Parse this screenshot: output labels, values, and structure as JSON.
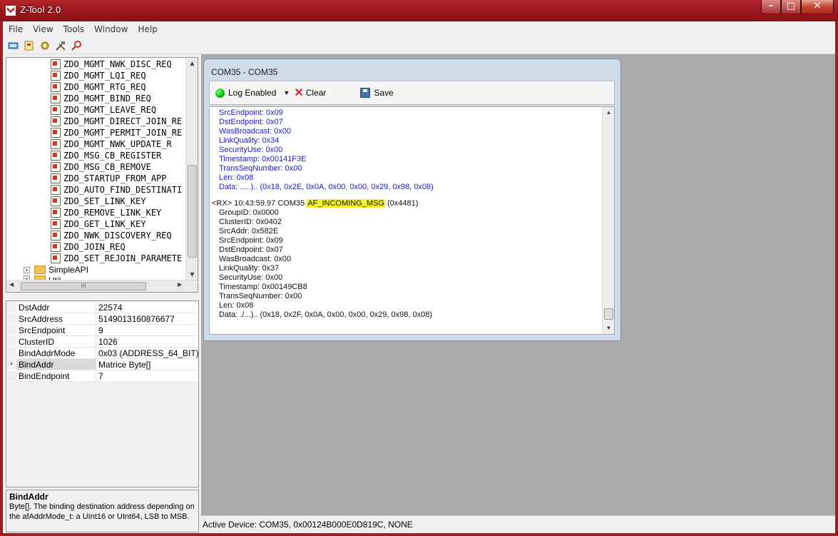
{
  "window": {
    "title": "Z-Tool 2.0",
    "minimize": "–",
    "maximize": "□",
    "close": "✕"
  },
  "menu": [
    "File",
    "View",
    "Tools",
    "Window",
    "Help"
  ],
  "toolbar": {
    "icons": [
      "device-icon",
      "open-icon",
      "settings-icon",
      "tools-icon",
      "search-icon"
    ]
  },
  "tree": {
    "items": [
      "ZDO_MGMT_NWK_DISC_REQ",
      "ZDO_MGMT_LQI_REQ",
      "ZDO_MGMT_RTG_REQ",
      "ZDO_MGMT_BIND_REQ",
      "ZDO_MGMT_LEAVE_REQ",
      "ZDO_MGMT_DIRECT_JOIN_RE",
      "ZDO_MGMT_PERMIT_JOIN_RE",
      "ZDO_MGMT_NWK_UPDATE_R",
      "ZDO_MSG_CB_REGISTER",
      "ZDO_MSG_CB_REMOVE",
      "ZDO_STARTUP_FROM_APP",
      "ZDO_AUTO_FIND_DESTINATI",
      "ZDO_SET_LINK_KEY",
      "ZDO_REMOVE_LINK_KEY",
      "ZDO_GET_LINK_KEY",
      "ZDO_NWK_DISCOVERY_REQ",
      "ZDO_JOIN_REQ",
      "ZDO_SET_REJOIN_PARAMETE"
    ],
    "folders": [
      "SimpleAPI",
      "Util"
    ],
    "hscroll_glyph": "III"
  },
  "properties": [
    {
      "name": "DstAddr",
      "value": "22574",
      "expander": ""
    },
    {
      "name": "SrcAddress",
      "value": "5149013160876677",
      "expander": ""
    },
    {
      "name": "SrcEndpoint",
      "value": "9",
      "expander": ""
    },
    {
      "name": "ClusterID",
      "value": "1026",
      "expander": ""
    },
    {
      "name": "BindAddrMode",
      "value": "0x03 (ADDRESS_64_BIT)",
      "expander": ""
    },
    {
      "name": "BindAddr",
      "value": "Matrice Byte[]",
      "expander": "+"
    },
    {
      "name": "BindEndpoint",
      "value": "7",
      "expander": ""
    }
  ],
  "help": {
    "title": "BindAddr",
    "text": "Byte[].  The binding destination address depending on the afAddrMode_t: a UInt16 or UInt64, LSB to MSB."
  },
  "child_window": {
    "title": "COM35 - COM35",
    "log_enabled_label": "Log Enabled",
    "clear_label": "Clear",
    "save_label": "Save"
  },
  "log": {
    "prev_lines": [
      "SrcEndpoint: 0x09",
      "DstEndpoint: 0x07",
      "WasBroadcast: 0x00",
      "LinkQuality: 0x34",
      "SecurityUse: 0x00",
      "Timestamp: 0x00141F3E",
      "TransSeqNumber: 0x00",
      "Len: 0x08",
      "Data: .....).. (0x18, 0x2E, 0x0A, 0x00, 0x00, 0x29, 0x98, 0x08)"
    ],
    "rx_prefix": "<RX> 10:43:59.97 COM35 ",
    "rx_msg": "AF_INCOMING_MSG",
    "rx_suffix": " (0x4481)",
    "cur_lines": [
      "GroupID: 0x0000",
      "ClusterID: 0x0402",
      "SrcAddr: 0x582E",
      "SrcEndpoint: 0x09",
      "DstEndpoint: 0x07",
      "WasBroadcast: 0x00",
      "LinkQuality: 0x37",
      "SecurityUse: 0x00",
      "Timestamp: 0x00149CB8",
      "TransSeqNumber: 0x00",
      "Len: 0x08",
      "Data: ./...).. (0x18, 0x2F, 0x0A, 0x00, 0x00, 0x29, 0x98, 0x08)"
    ]
  },
  "status": {
    "text": "Active Device: COM35, 0x00124B000E0D819C, NONE"
  },
  "colors": {
    "titlebar": "#98161b",
    "log_blue": "#1a1acc",
    "highlight": "#f4f229"
  }
}
